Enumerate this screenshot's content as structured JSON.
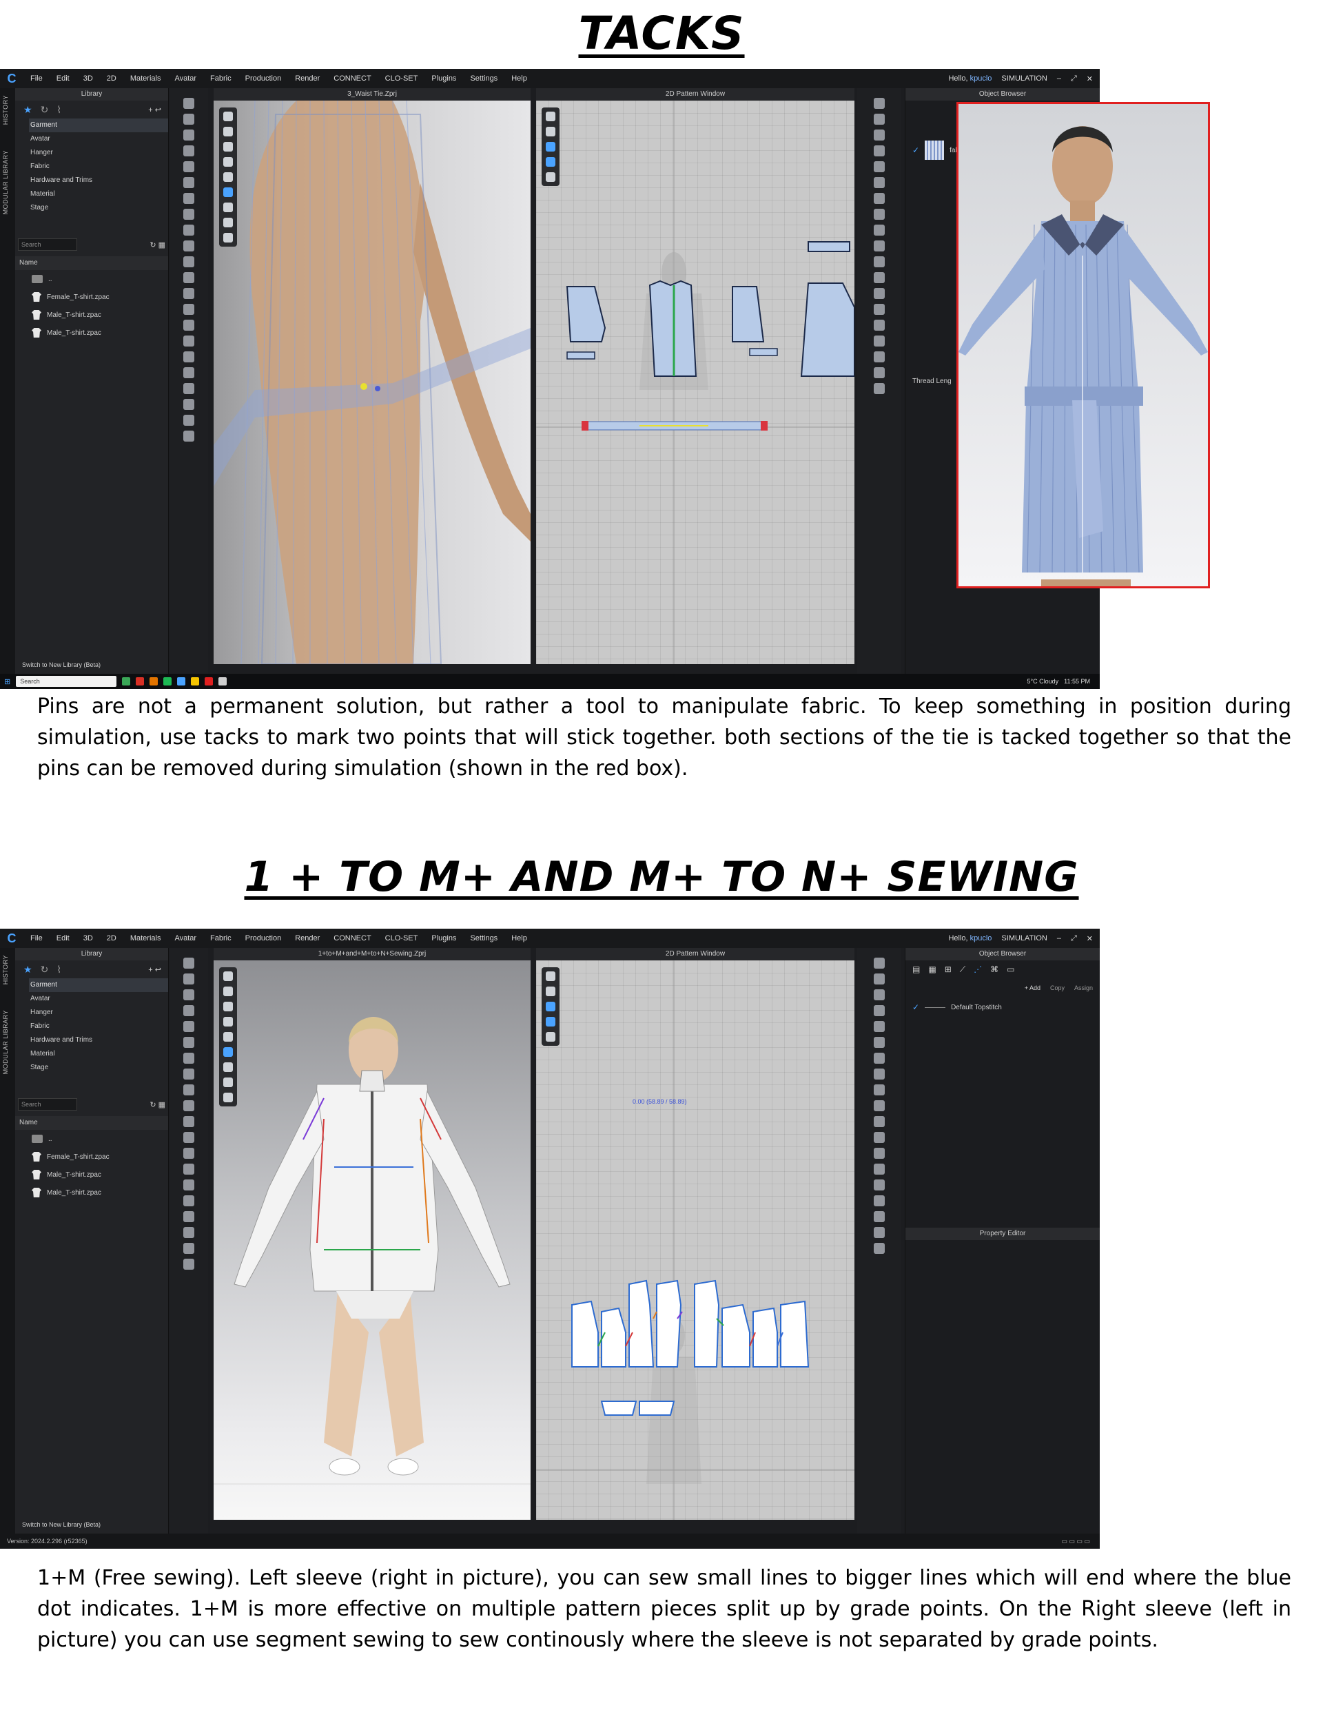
{
  "section1": {
    "heading": "TACKS",
    "caption": "Pins are not a permanent solution, but rather a tool to manipulate fabric. To keep something in position during simulation, use tacks to mark two points that will stick together. both sections of the tie is tacked together so that the pins can be removed during simulation (shown in the red box).",
    "app": {
      "menu": [
        "File",
        "Edit",
        "3D",
        "2D",
        "Materials",
        "Avatar",
        "Fabric",
        "Production",
        "Render",
        "CONNECT",
        "CLO-SET",
        "Plugins",
        "Settings",
        "Help"
      ],
      "greeting": "Hello,",
      "username": "kpuclo",
      "mode": "SIMULATION",
      "vertical_tabs": [
        "HISTORY",
        "MODULAR LIBRARY"
      ],
      "library_title": "Library",
      "tree": [
        "Garment",
        "Avatar",
        "Hanger",
        "Fabric",
        "Hardware and Trims",
        "Material",
        "Stage"
      ],
      "search_placeholder": "Search",
      "name_header": "Name",
      "files": [
        "..",
        "Female_T-shirt.zpac",
        "Male_T-shirt.zpac",
        "Male_T-shirt.zpac"
      ],
      "switch_library": "Switch to New Library (Beta)",
      "viewport3d_title": "3_Waist Tie.Zprj",
      "viewport2d_title": "2D Pattern Window",
      "right_panel_title": "Object Browser",
      "right_panel_item": "fab",
      "thread_label": "Thread Leng",
      "taskbar_search": "Search",
      "weather": "5°C Cloudy",
      "time": "11:55 PM"
    }
  },
  "section2": {
    "heading": "1 + TO M+ AND M+ TO N+ SEWING",
    "caption": "1+M (Free sewing). Left sleeve (right in picture), you can sew small lines to bigger lines which will end where the blue dot indicates. 1+M is more effective on multiple pattern pieces split up by grade points. On the Right sleeve (left in picture) you can use segment sewing to sew continously where the sleeve is not separated by grade points.",
    "app": {
      "menu": [
        "File",
        "Edit",
        "3D",
        "2D",
        "Materials",
        "Avatar",
        "Fabric",
        "Production",
        "Render",
        "CONNECT",
        "CLO-SET",
        "Plugins",
        "Settings",
        "Help"
      ],
      "greeting": "Hello,",
      "username": "kpuclo",
      "mode": "SIMULATION",
      "vertical_tabs": [
        "HISTORY",
        "MODULAR LIBRARY"
      ],
      "library_title": "Library",
      "tree": [
        "Garment",
        "Avatar",
        "Hanger",
        "Fabric",
        "Hardware and Trims",
        "Material",
        "Stage"
      ],
      "search_placeholder": "Search",
      "name_header": "Name",
      "files": [
        "..",
        "Female_T-shirt.zpac",
        "Male_T-shirt.zpac",
        "Male_T-shirt.zpac"
      ],
      "switch_library": "Switch to New Library (Beta)",
      "viewport3d_title": "1+to+M+and+M+to+N+Sewing.Zprj",
      "viewport2d_title": "2D Pattern Window",
      "measure_readout": "0.00 (58.89 / 58.89)",
      "right_panel_title": "Object Browser",
      "add_label": "+ Add",
      "copy_label": "Copy",
      "assign_label": "Assign",
      "topstitch_item": "Default Topstitch",
      "property_editor": "Property Editor",
      "version": "Version: 2024.2.296 (r52365)"
    }
  },
  "colors": {
    "accent": "#4aa3ff",
    "red_box": "#e02020",
    "app_bg": "#1c1d20"
  }
}
